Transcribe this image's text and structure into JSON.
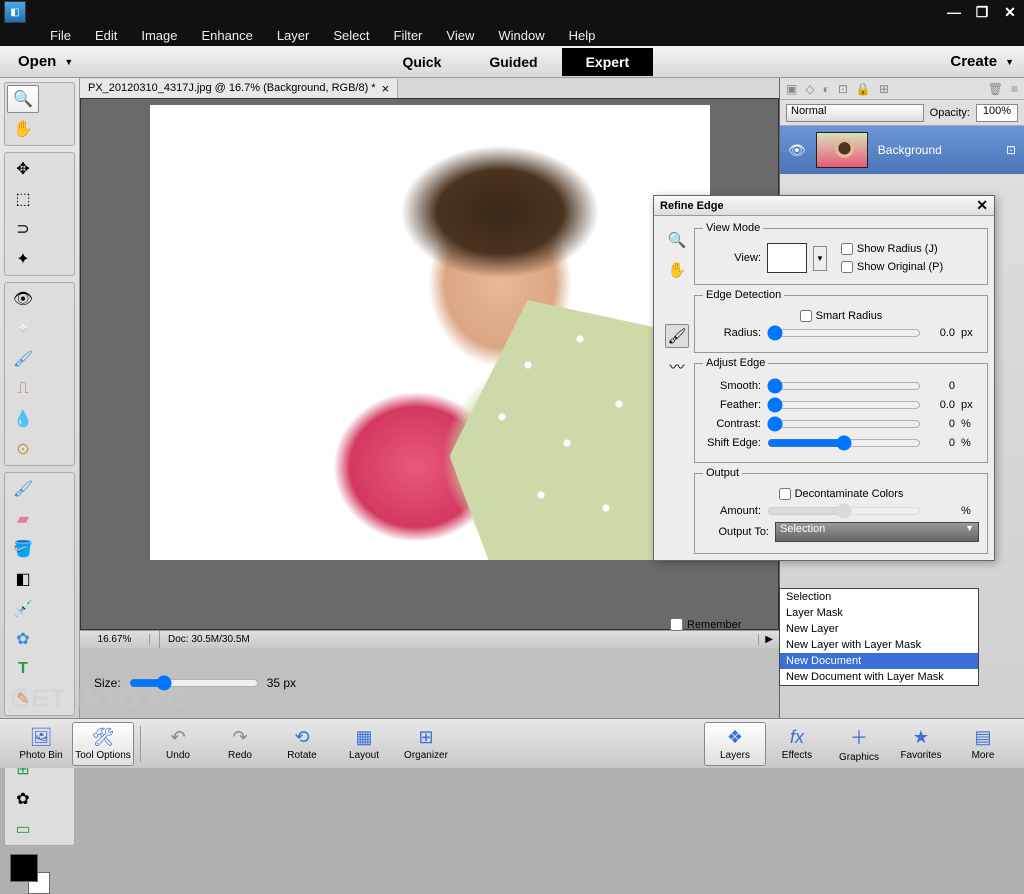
{
  "menu": [
    "File",
    "Edit",
    "Image",
    "Enhance",
    "Layer",
    "Select",
    "Filter",
    "View",
    "Window",
    "Help"
  ],
  "modebar": {
    "open": "Open",
    "quick": "Quick",
    "guided": "Guided",
    "expert": "Expert",
    "create": "Create"
  },
  "doc_tab": {
    "title": "PX_20120310_4317J.jpg @ 16.7% (Background, RGB/8) *"
  },
  "doc_status": {
    "zoom": "16.67%",
    "info": "Doc: 30.5M/30.5M"
  },
  "options": {
    "size_label": "Size:",
    "size_value": "35 px"
  },
  "layers_panel": {
    "blend_mode": "Normal",
    "opacity_label": "Opacity:",
    "opacity_value": "100%",
    "layer_name": "Background"
  },
  "dialog": {
    "title": "Refine Edge",
    "view_mode": {
      "legend": "View Mode",
      "view_label": "View:",
      "show_radius": "Show Radius (J)",
      "show_original": "Show Original (P)"
    },
    "edge_detection": {
      "legend": "Edge Detection",
      "smart_radius": "Smart Radius",
      "radius_label": "Radius:",
      "radius_val": "0.0",
      "radius_unit": "px"
    },
    "adjust_edge": {
      "legend": "Adjust Edge",
      "smooth": {
        "label": "Smooth:",
        "val": "0",
        "unit": ""
      },
      "feather": {
        "label": "Feather:",
        "val": "0.0",
        "unit": "px"
      },
      "contrast": {
        "label": "Contrast:",
        "val": "0",
        "unit": "%"
      },
      "shift": {
        "label": "Shift Edge:",
        "val": "0",
        "unit": "%"
      }
    },
    "output": {
      "legend": "Output",
      "decontaminate": "Decontaminate Colors",
      "amount_label": "Amount:",
      "amount_unit": "%",
      "output_to": "Output To:",
      "selected": "Selection"
    },
    "remember": "Remember",
    "dropdown": [
      "Selection",
      "Layer Mask",
      "New Layer",
      "New Layer with Layer Mask",
      "New Document",
      "New Document with Layer Mask"
    ],
    "dropdown_selected_index": 4
  },
  "bottombar": {
    "left": [
      "Photo Bin",
      "Tool Options",
      "Undo",
      "Redo",
      "Rotate",
      "Layout",
      "Organizer"
    ],
    "right": [
      "Layers",
      "Effects",
      "Graphics",
      "Favorites",
      "More"
    ]
  },
  "watermark": "GET INTO PC"
}
